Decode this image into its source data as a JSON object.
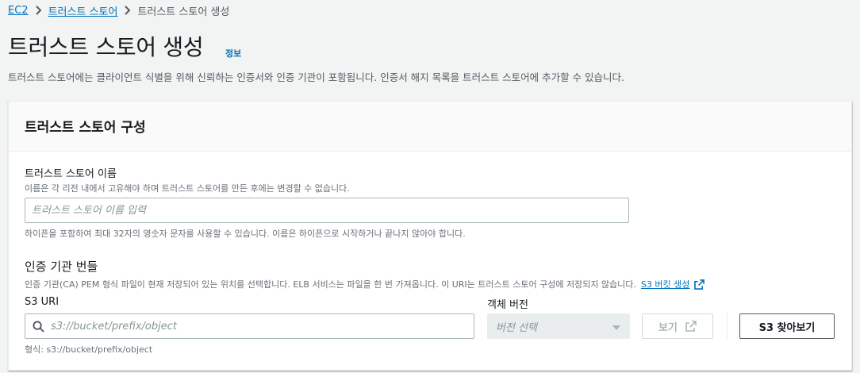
{
  "breadcrumb": {
    "items": [
      "EC2",
      "트러스트 스토어"
    ],
    "current": "트러스트 스토어 생성"
  },
  "header": {
    "title": "트러스트 스토어 생성",
    "info": "정보",
    "description": "트러스트 스토어에는 클라이언트 식별을 위해 신뢰하는 인증서와 인증 기관이 포함됩니다. 인증서 해지 목록을 트러스트 스토어에 추가할 수 있습니다."
  },
  "panel": {
    "title": "트러스트 스토어 구성",
    "name_field": {
      "label": "트러스트 스토어 이름",
      "description": "이름은 각 리전 내에서 고유해야 하며 트러스트 스토어를 만든 후에는 변경할 수 없습니다.",
      "placeholder": "트러스트 스토어 이름 입력",
      "constraint": "하이픈을 포함하여 최대 32자의 영숫자 문자를 사용할 수 있습니다. 이름은 하이픈으로 시작하거나 끝나지 않아야 합니다."
    },
    "bundle": {
      "label": "인증 기관 번들",
      "description": "인증 기관(CA) PEM 형식 파일이 현재 저장되어 있는 위치를 선택합니다. ELB 서비스는 파일을 한 번 가져옵니다. 이 URI는 트러스트 스토어 구성에 저장되지 않습니다.",
      "create_bucket_link": "S3 버킷 생성",
      "s3_uri_label": "S3 URI",
      "s3_uri_placeholder": "s3://bucket/prefix/object",
      "version_label": "객체 버전",
      "version_placeholder": "버전 선택",
      "view_button": "보기",
      "browse_button": "S3 찾아보기",
      "format_hint": "형식: s3://bucket/prefix/object"
    }
  },
  "colors": {
    "link": "#0073bb",
    "text": "#16191f",
    "secondary_text": "#687078",
    "background": "#f2f3f3"
  },
  "icons": {
    "breadcrumb_separator": "chevron-right-icon",
    "search": "search-icon",
    "external": "external-link-icon",
    "dropdown": "caret-down-icon"
  }
}
